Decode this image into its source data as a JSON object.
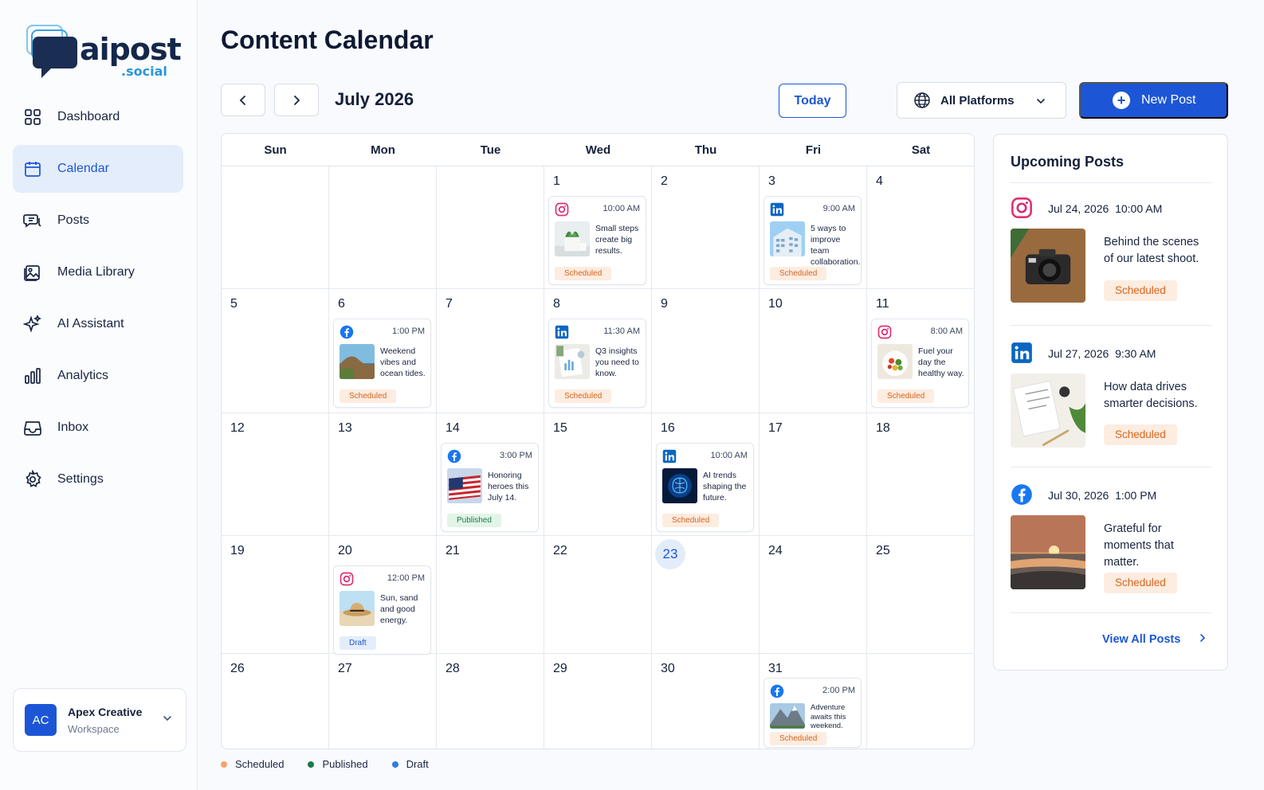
{
  "brand": {
    "name": "aipost",
    "suffix": ".social",
    "accent": "#1c56d6"
  },
  "sidebar": {
    "items": [
      {
        "label": "Dashboard",
        "icon": "grid-icon"
      },
      {
        "label": "Calendar",
        "icon": "calendar-icon",
        "active": true
      },
      {
        "label": "Posts",
        "icon": "chat-icon"
      },
      {
        "label": "Media Library",
        "icon": "image-icon"
      },
      {
        "label": "AI Assistant",
        "icon": "sparkle-icon"
      },
      {
        "label": "Analytics",
        "icon": "bar-chart-icon"
      },
      {
        "label": "Inbox",
        "icon": "inbox-icon"
      },
      {
        "label": "Settings",
        "icon": "gear-icon"
      }
    ],
    "workspace": {
      "initials": "AC",
      "name": "Apex Creative",
      "label": "Workspace"
    }
  },
  "header": {
    "title": "Content Calendar",
    "month": "July 2026",
    "today_label": "Today",
    "platform_filter": "All Platforms",
    "new_post_label": "New Post"
  },
  "calendar": {
    "weekdays": [
      "Sun",
      "Mon",
      "Tue",
      "Wed",
      "Thu",
      "Fri",
      "Sat"
    ],
    "weeks": [
      [
        "",
        "",
        "",
        "1",
        "2",
        "3",
        "4"
      ],
      [
        "5",
        "6",
        "7",
        "8",
        "9",
        "10",
        "11"
      ],
      [
        "12",
        "13",
        "14",
        "15",
        "16",
        "17",
        "18"
      ],
      [
        "19",
        "20",
        "21",
        "22",
        "23",
        "24",
        "25"
      ],
      [
        "26",
        "27",
        "28",
        "29",
        "30",
        "31",
        ""
      ]
    ],
    "today": "23",
    "posts": [
      {
        "day": "1",
        "platform": "instagram",
        "time": "10:00 AM",
        "text": "Small steps create big results.",
        "status": "Scheduled",
        "thumb": "plant"
      },
      {
        "day": "3",
        "platform": "linkedin",
        "time": "9:00 AM",
        "text": "5 ways to improve team collaboration.",
        "status": "Scheduled",
        "thumb": "building"
      },
      {
        "day": "6",
        "platform": "facebook",
        "time": "1:00 PM",
        "text": "Weekend vibes and ocean tides.",
        "status": "Scheduled",
        "thumb": "coast"
      },
      {
        "day": "8",
        "platform": "linkedin",
        "time": "11:30 AM",
        "text": "Q3 insights you need to know.",
        "status": "Scheduled",
        "thumb": "report"
      },
      {
        "day": "11",
        "platform": "instagram",
        "time": "8:00 AM",
        "text": "Fuel your day the healthy way.",
        "status": "Scheduled",
        "thumb": "salad"
      },
      {
        "day": "14",
        "platform": "facebook",
        "time": "3:00 PM",
        "text": "Honoring heroes this July 14.",
        "status": "Published",
        "thumb": "flag"
      },
      {
        "day": "16",
        "platform": "linkedin",
        "time": "10:00 AM",
        "text": "AI trends shaping the future.",
        "status": "Scheduled",
        "thumb": "brain"
      },
      {
        "day": "20",
        "platform": "instagram",
        "time": "12:00 PM",
        "text": "Sun, sand and good energy.",
        "status": "Draft",
        "thumb": "hat"
      },
      {
        "day": "31",
        "platform": "facebook",
        "time": "2:00 PM",
        "text": "Adventure awaits this weekend.",
        "status": "Scheduled",
        "thumb": "mountain"
      }
    ]
  },
  "legend": [
    {
      "label": "Scheduled",
      "color": "#f5a46a"
    },
    {
      "label": "Published",
      "color": "#1c7a45"
    },
    {
      "label": "Draft",
      "color": "#2f7ae5"
    }
  ],
  "upcoming": {
    "title": "Upcoming Posts",
    "items": [
      {
        "platform": "instagram",
        "date": "Jul 24, 2026",
        "time": "10:00 AM",
        "text": "Behind the scenes of our latest shoot.",
        "status": "Scheduled",
        "thumb": "camera"
      },
      {
        "platform": "linkedin",
        "date": "Jul 27, 2026",
        "time": "9:30 AM",
        "text": "How data drives smarter decisions.",
        "status": "Scheduled",
        "thumb": "desk"
      },
      {
        "platform": "facebook",
        "date": "Jul 30, 2026",
        "time": "1:00 PM",
        "text": "Grateful for moments that matter.",
        "status": "Scheduled",
        "thumb": "sunset"
      }
    ],
    "view_all": "View All Posts"
  }
}
